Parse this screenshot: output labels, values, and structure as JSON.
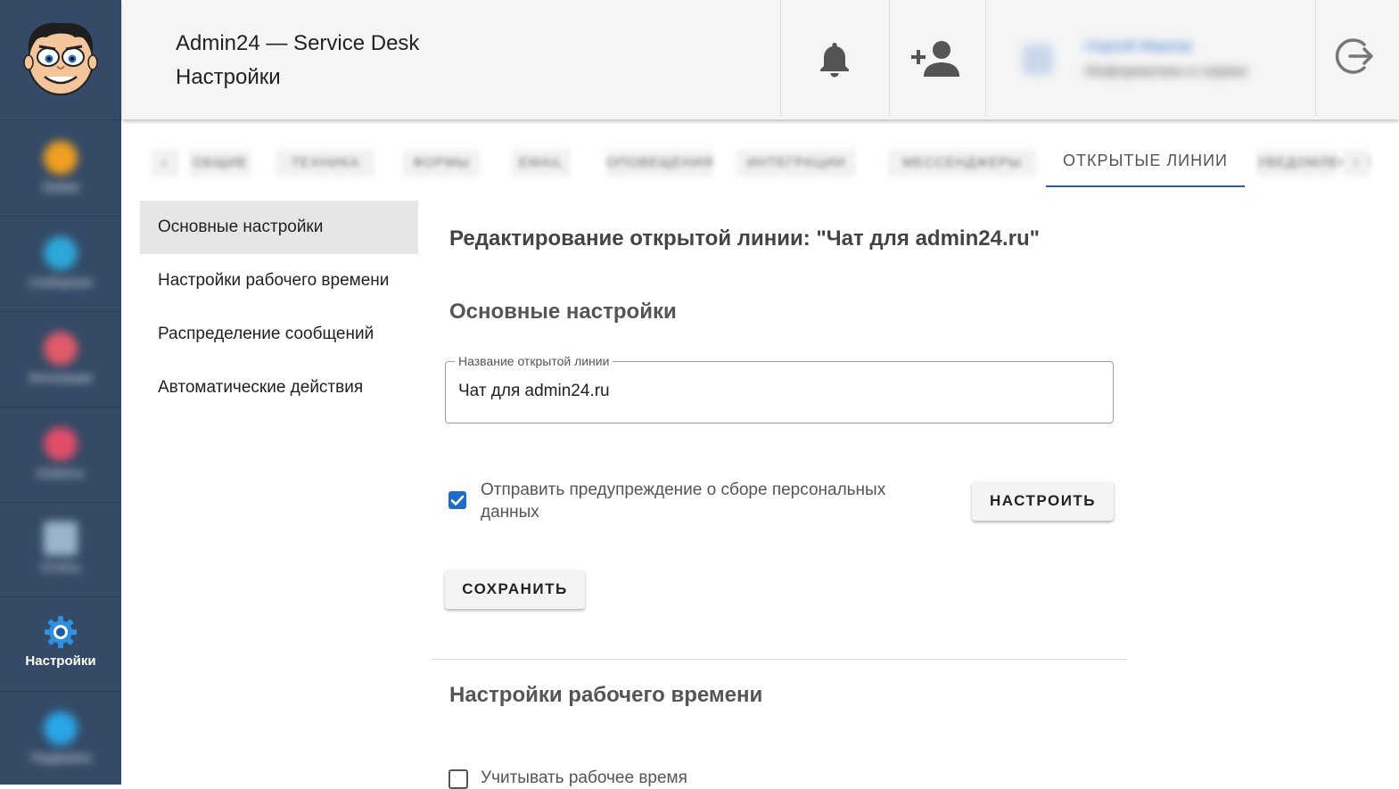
{
  "app": {
    "title": "Admin24 — Service Desk",
    "subtitle": "Настройки"
  },
  "sidebar": {
    "items": [
      {
        "label": "Заявки",
        "icon": "tickets-icon",
        "color": "#f0a020"
      },
      {
        "label": "Сообщения",
        "icon": "chat-icon",
        "color": "#2ea8d8"
      },
      {
        "label": "Интеграции",
        "icon": "integrations-icon",
        "color": "#e05a6a"
      },
      {
        "label": "Клиенты",
        "icon": "clients-icon",
        "color": "#e24d6a"
      },
      {
        "label": "Отчёты",
        "icon": "reports-icon",
        "color": "#9bb5d0"
      },
      {
        "label": "Настройки",
        "icon": "gear-icon",
        "color": "#2f8fe0"
      },
      {
        "label": "Поддержка",
        "icon": "support-icon",
        "color": "#2aa6e8"
      }
    ]
  },
  "header": {
    "user": {
      "name": "Сергей Иванов",
      "role": "Информатика и сервис"
    }
  },
  "tabs": {
    "items": [
      "ОБЩИЕ",
      "ТЕХНИКА",
      "ФОРМЫ",
      "EMAIL",
      "ОПОВЕЩЕНИЯ",
      "ИНТЕГРАЦИИ",
      "МЕССЕНДЖЕРЫ",
      "ОТКРЫТЫЕ ЛИНИИ",
      "УВЕДОМЛЕНИЯ"
    ],
    "active": "ОТКРЫТЫЕ ЛИНИИ"
  },
  "submenu": {
    "items": [
      "Основные настройки",
      "Настройки рабочего времени",
      "Распределение сообщений",
      "Автоматические действия"
    ]
  },
  "main": {
    "title": "Редактирование открытой линии: \"Чат для admin24.ru\"",
    "section1": "Основные настройки",
    "field_label": "Название открытой линии",
    "field_value": "Чат для admin24.ru",
    "checkbox_label": "Отправить предупреждение о сборе персональных данных",
    "checkbox_checked": true,
    "configure_button": "НАСТРОИТЬ",
    "save_button": "СОХРАНИТЬ",
    "section2": "Настройки рабочего времени",
    "worktime_checkbox_label": "Учитывать рабочее время",
    "worktime_checked": false
  },
  "colors": {
    "sidebar": "#344a66",
    "accent": "#1f6cc7",
    "tab_underline": "#2f5d8a"
  }
}
